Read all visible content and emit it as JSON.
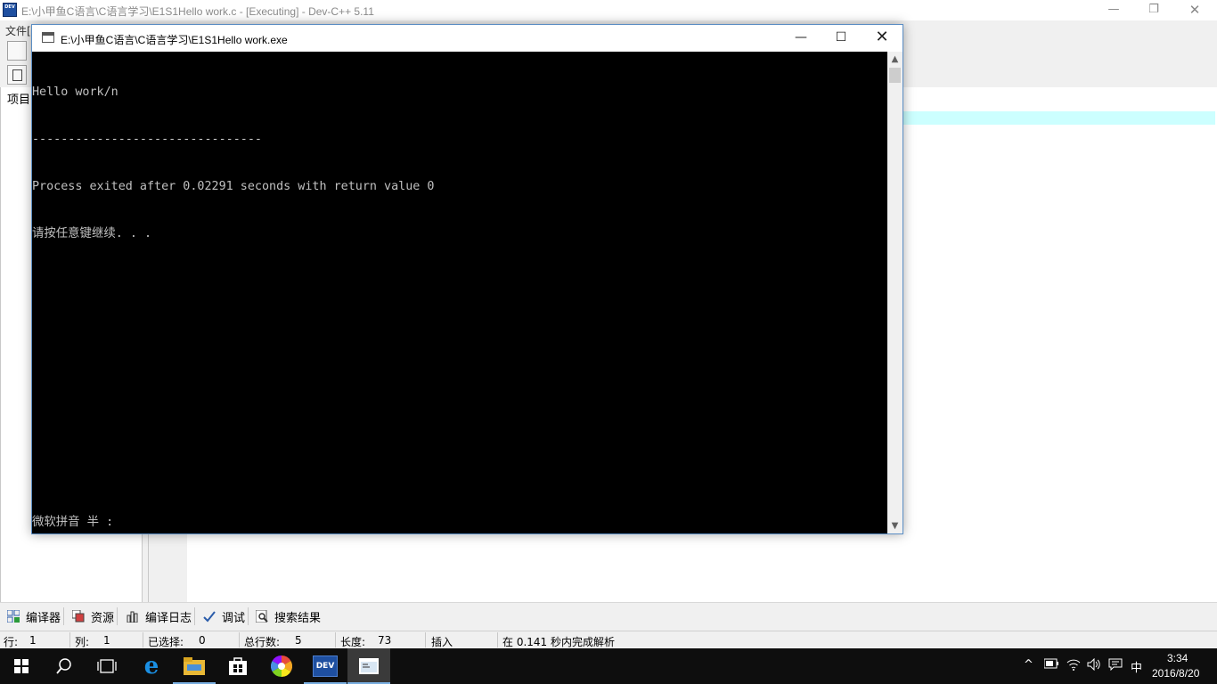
{
  "ide": {
    "app_icon_text": "DEV",
    "title": "E:\\小甲鱼C语言\\C语言学习\\E1S1Hello work.c - [Executing] - Dev-C++ 5.11",
    "window_controls": {
      "minimize": "—",
      "restore": "❐",
      "close": "✕"
    },
    "menu_visible_text": "文件[",
    "left_tab": "项目"
  },
  "bottom_tabs": [
    {
      "label": "编译器"
    },
    {
      "label": "资源"
    },
    {
      "label": "编译日志"
    },
    {
      "label": "调试"
    },
    {
      "label": "搜索结果"
    }
  ],
  "statusbar": {
    "row_label": "行:",
    "row_value": "1",
    "col_label": "列:",
    "col_value": "1",
    "sel_label": "已选择:",
    "sel_value": "0",
    "lines_label": "总行数:",
    "lines_value": "5",
    "len_label": "长度:",
    "len_value": "73",
    "mode": "插入",
    "parse_msg": "在 0.141 秒内完成解析"
  },
  "console": {
    "title": "E:\\小甲鱼C语言\\C语言学习\\E1S1Hello work.exe",
    "controls": {
      "minimize": "—",
      "maximize": "☐",
      "close": "✕"
    },
    "lines": [
      "Hello work/n",
      "--------------------------------",
      "Process exited after 0.02291 seconds with return value 0",
      "请按任意键继续. . ."
    ],
    "ime_status": "微软拼音 半 :",
    "scroll_up": "▲",
    "scroll_down": "▼"
  },
  "taskbar": {
    "apps": [
      {
        "name": "start",
        "glyph": ""
      },
      {
        "name": "search",
        "glyph": ""
      },
      {
        "name": "task-view",
        "glyph": ""
      },
      {
        "name": "edge",
        "glyph": "e"
      },
      {
        "name": "file-explorer",
        "glyph": ""
      },
      {
        "name": "store",
        "glyph": ""
      },
      {
        "name": "photos",
        "glyph": ""
      },
      {
        "name": "dev-cpp",
        "glyph": "DEV"
      },
      {
        "name": "console",
        "glyph": ""
      }
    ],
    "tray": {
      "chevron": "^",
      "ime_lang": "中",
      "time": "3:34",
      "date": "2016/8/20"
    }
  },
  "colors": {
    "console_bg": "#000000",
    "console_text": "#c0c0c0",
    "taskbar_bg": "#0e0e0e",
    "editor_current_line": "#ccffff",
    "taskbar_active_underline": "#79aee0"
  }
}
